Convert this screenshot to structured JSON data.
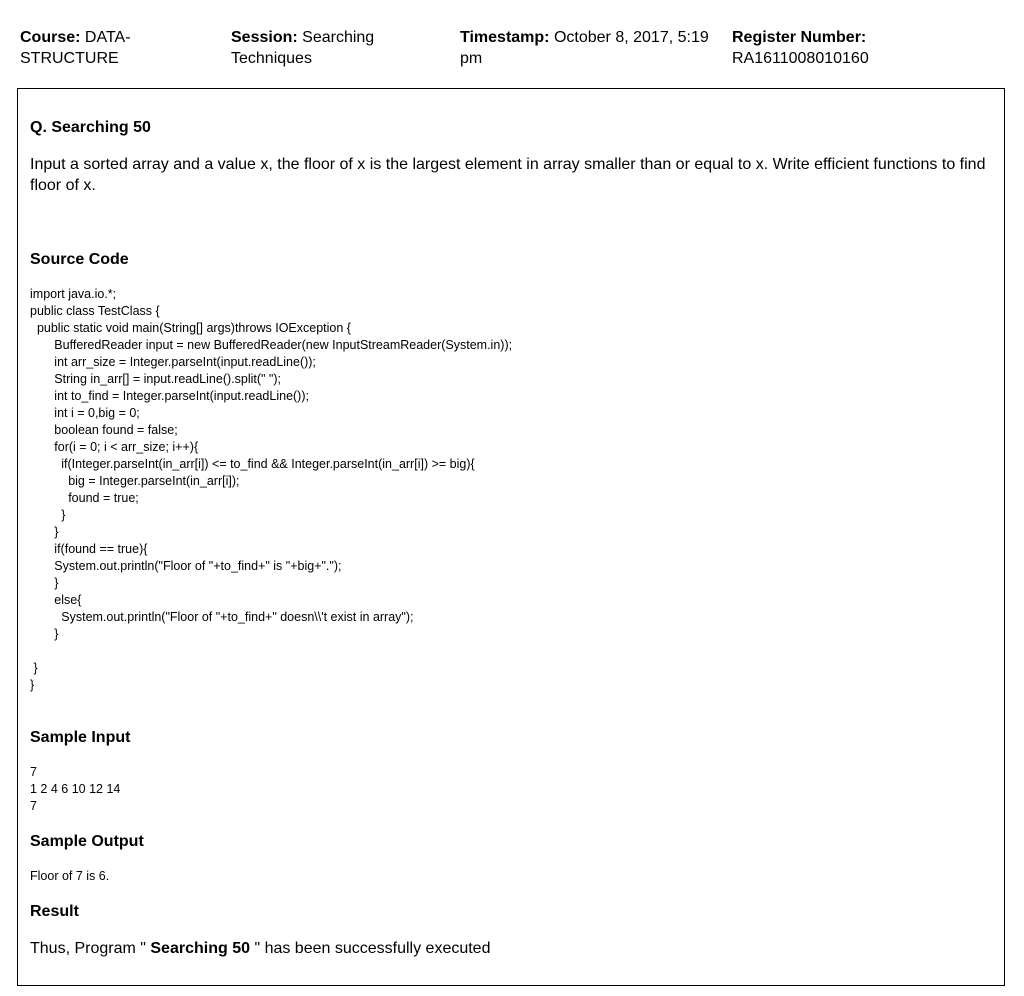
{
  "header": {
    "course_label": "Course:",
    "course_value": "DATA-STRUCTURE",
    "session_label": "Session:",
    "session_value": "Searching Techniques",
    "timestamp_label": "Timestamp:",
    "timestamp_value": "October 8, 2017, 5:19 pm",
    "register_label": "Register Number:",
    "register_value": "RA1611008010160"
  },
  "question": {
    "title": "Q. Searching 50",
    "text": "Input a sorted array and a value x, the floor of x is the largest element in array smaller than or equal to x. Write efficient functions to find floor of x."
  },
  "source": {
    "heading": "Source Code",
    "code": "import java.io.*;\npublic class TestClass {\n  public static void main(String[] args)throws IOException {\n       BufferedReader input = new BufferedReader(new InputStreamReader(System.in));\n       int arr_size = Integer.parseInt(input.readLine());\n       String in_arr[] = input.readLine().split(\" \");\n       int to_find = Integer.parseInt(input.readLine());\n       int i = 0,big = 0;\n       boolean found = false;\n       for(i = 0; i < arr_size; i++){\n         if(Integer.parseInt(in_arr[i]) <= to_find && Integer.parseInt(in_arr[i]) >= big){\n           big = Integer.parseInt(in_arr[i]);\n           found = true;\n         }\n       }\n       if(found == true){\n       System.out.println(\"Floor of \"+to_find+\" is \"+big+\".\");\n       }\n       else{\n         System.out.println(\"Floor of \"+to_find+\" doesn\\\\'t exist in array\");\n       }\n\n }\n}"
  },
  "sample_input": {
    "heading": "Sample Input",
    "text": "7\n1 2 4 6 10 12 14\n7"
  },
  "sample_output": {
    "heading": "Sample Output",
    "text": "Floor of 7 is 6."
  },
  "result": {
    "heading": "Result",
    "prefix": "Thus, Program \"",
    "program_name": " Searching 50 ",
    "suffix": "\" has been successfully executed"
  }
}
